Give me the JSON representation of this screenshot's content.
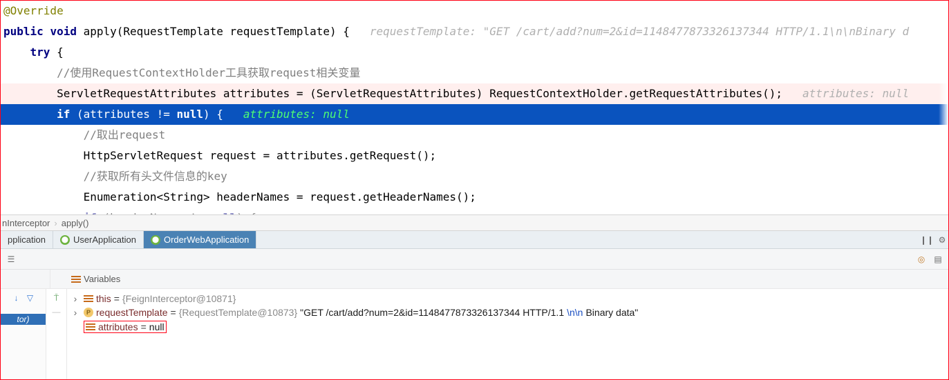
{
  "code": {
    "l1": "@Override",
    "l2_kw_public": "public",
    "l2_kw_void": "void",
    "l2_fn": "apply",
    "l2_sig": "(RequestTemplate requestTemplate)",
    "l2_hint": "requestTemplate: \"GET /cart/add?num=2&id=1148477873326137344 HTTP/1.1\\n\\nBinary d",
    "l3_try": "try",
    "l4_comment": "//使用RequestContextHolder工具获取request相关变量",
    "l5_text": "ServletRequestAttributes attributes = (ServletRequestAttributes) RequestContextHolder.getRequestAttributes();",
    "l5_hint": "attributes: null",
    "l6_if": "if",
    "l6_cond_a": "(attributes != ",
    "l6_null": "null",
    "l6_cond_b": ")",
    "l6_inline": "attributes: null",
    "l7_comment": "//取出request",
    "l8_text": "HttpServletRequest request = attributes.getRequest();",
    "l9_comment": "//获取所有头文件信息的key",
    "l10_text": "Enumeration<String> headerNames = request.getHeaderNames();",
    "l11_if": "if",
    "l11_cond": "(headerNames != ",
    "l11_null": "null",
    "l11_cond_b": ") {"
  },
  "breadcrumb": {
    "item1": "nInterceptor",
    "item2": "apply()"
  },
  "tabs": {
    "t1": "pplication",
    "t2": "UserApplication",
    "t3": "OrderWebApplication"
  },
  "panel": {
    "title": "Variables",
    "left_pill": "tor)"
  },
  "vars": {
    "this_name": "this",
    "this_val": "{FeignInterceptor@10871}",
    "rt_name": "requestTemplate",
    "rt_val_gray": "{RequestTemplate@10873}",
    "rt_val_str_a": " \"GET /cart/add?num=2&id=1148477873326137344 HTTP/1.1",
    "rt_val_esc": "\\n\\n",
    "rt_val_str_b": "Binary data\"",
    "attr_name": "attributes",
    "attr_val": "null"
  }
}
